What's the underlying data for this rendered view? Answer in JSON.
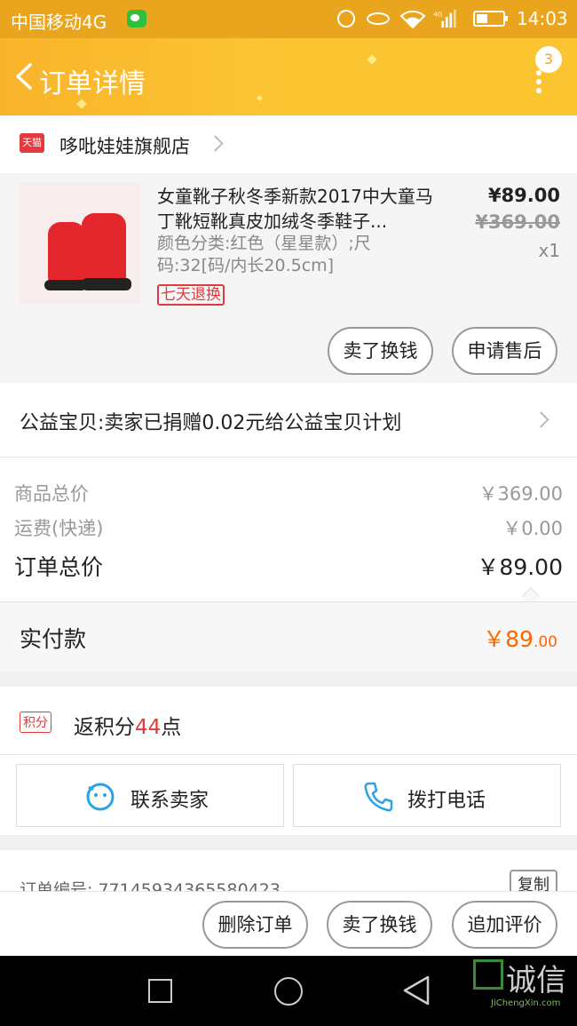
{
  "status_bar": {
    "carrier": "中国移动4G",
    "time": "14:03",
    "network": "4G"
  },
  "nav": {
    "title": "订单详情",
    "badge_count": "3"
  },
  "shop": {
    "platform_tag": "天猫",
    "name": "哆吡娃娃旗舰店"
  },
  "product": {
    "title": "女童靴子秋冬季新款2017中大童马丁靴短靴真皮加绒冬季鞋子...",
    "sku": "颜色分类:红色（星星款）;尺码:32[码/内长20.5cm]",
    "tag": "七天退换",
    "price": "¥89.00",
    "original_price": "¥369.00",
    "quantity": "x1",
    "actions": {
      "sell": "卖了换钱",
      "after_sale": "申请售后"
    }
  },
  "donation": {
    "text": "公益宝贝:卖家已捐赠0.02元给公益宝贝计划"
  },
  "summary": {
    "goods_label": "商品总价",
    "goods_value": "￥369.00",
    "shipping_label": "运费(快递)",
    "shipping_value": "￥0.00",
    "total_label": "订单总价",
    "total_value": "￥89.00",
    "paid_label": "实付款",
    "paid_symbol": "￥",
    "paid_int": "89",
    "paid_dec": ".00"
  },
  "points": {
    "tag": "积分",
    "prefix": "返积分",
    "count": "44",
    "suffix": "点"
  },
  "contact": {
    "seller": "联系卖家",
    "call": "拨打电话"
  },
  "order": {
    "number": "订单编号: 77145934365580423",
    "copy": "复制"
  },
  "bottom_actions": {
    "delete": "删除订单",
    "sell": "卖了换钱",
    "review": "追加评价"
  },
  "watermark": {
    "text": "诚信",
    "sub": "JiChengXin.com"
  },
  "colors": {
    "accent": "#fbc532",
    "price_highlight": "#ff6600",
    "tmall_red": "#e4393c"
  }
}
